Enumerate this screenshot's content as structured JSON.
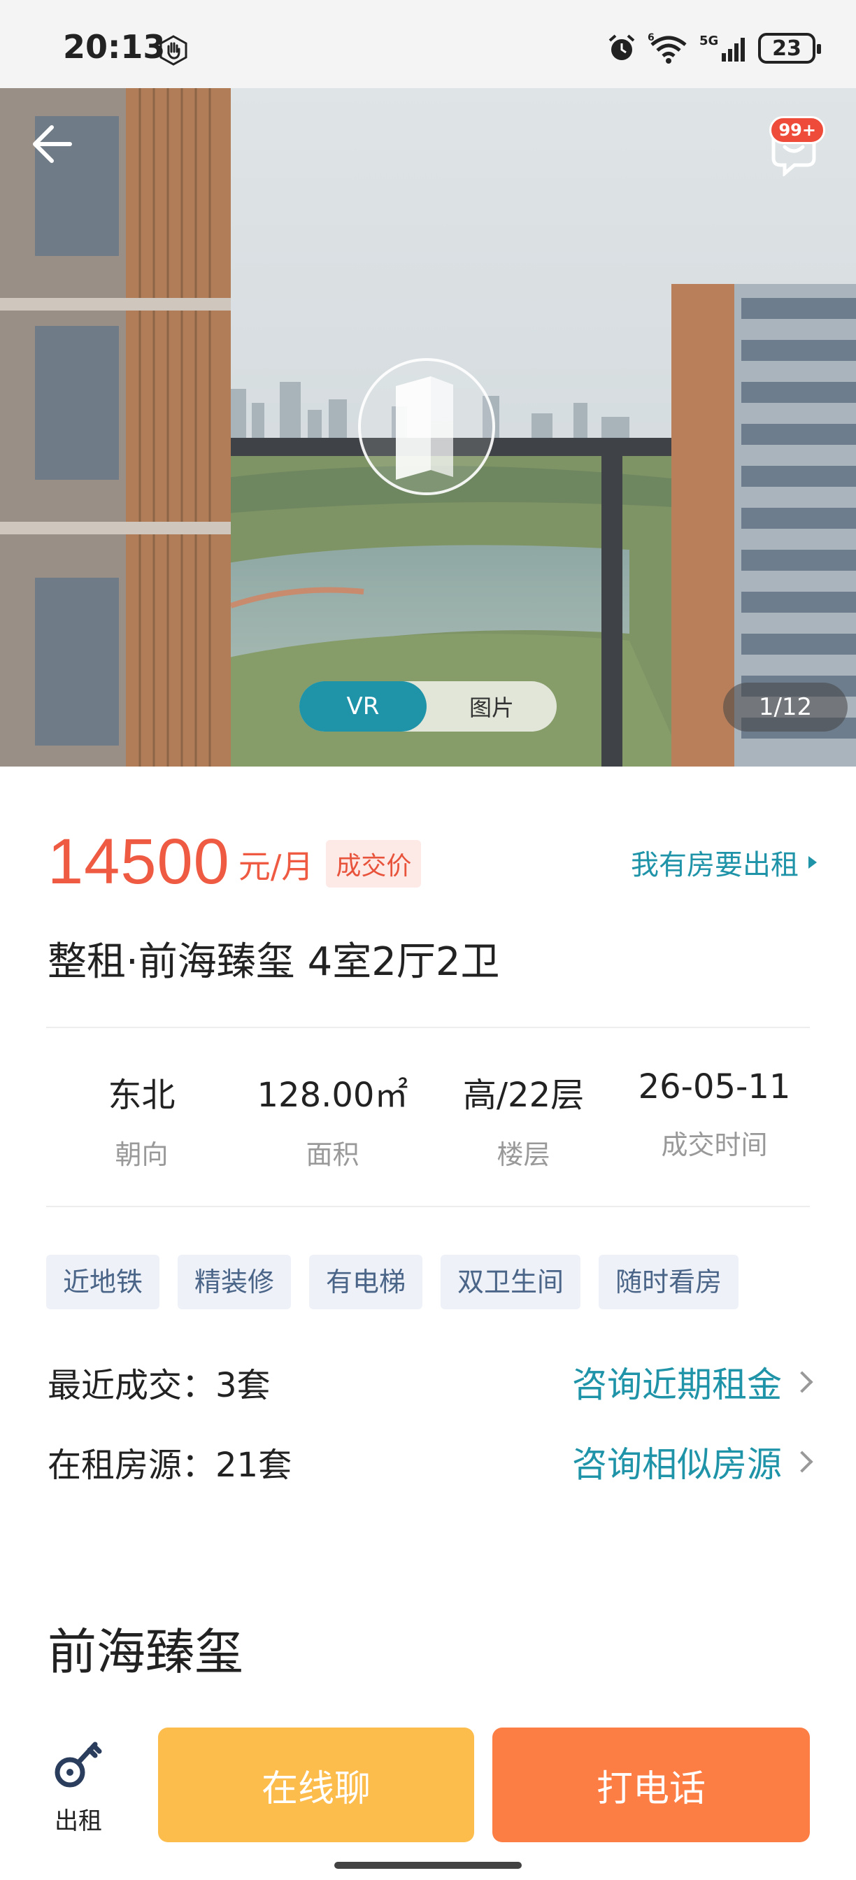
{
  "status_bar": {
    "time": "20:13",
    "network_badge": "5G",
    "wifi_badge": "6",
    "battery": "23"
  },
  "hero": {
    "message_badge": "99+",
    "toggle": {
      "vr_label": "VR",
      "pictures_label": "图片"
    },
    "counter": "1/12"
  },
  "listing": {
    "price": "14500",
    "unit": "元/月",
    "price_tag": "成交价",
    "rent_out_link": "我有房要出租",
    "title": "整租·前海臻玺 4室2厅2卫",
    "stats": [
      {
        "value": "东北",
        "label": "朝向"
      },
      {
        "value": "128.00㎡",
        "label": "面积"
      },
      {
        "value": "高/22层",
        "label": "楼层"
      },
      {
        "value": "26-05-11",
        "label": "成交时间"
      }
    ],
    "tags": [
      "近地铁",
      "精装修",
      "有电梯",
      "双卫生间",
      "随时看房"
    ],
    "recent_deals": {
      "label": "最近成交：3套",
      "link": "咨询近期租金"
    },
    "on_rent": {
      "label": "在租房源：21套",
      "link": "咨询相似房源"
    },
    "community_name": "前海臻玺"
  },
  "bottom_bar": {
    "rent_label": "出租",
    "chat_button": "在线聊",
    "call_button": "打电话"
  },
  "colors": {
    "accent_teal": "#1f93a8",
    "price_red": "#ef5a42",
    "chat_yellow": "#fdbd4d",
    "call_orange": "#fd7e45"
  }
}
